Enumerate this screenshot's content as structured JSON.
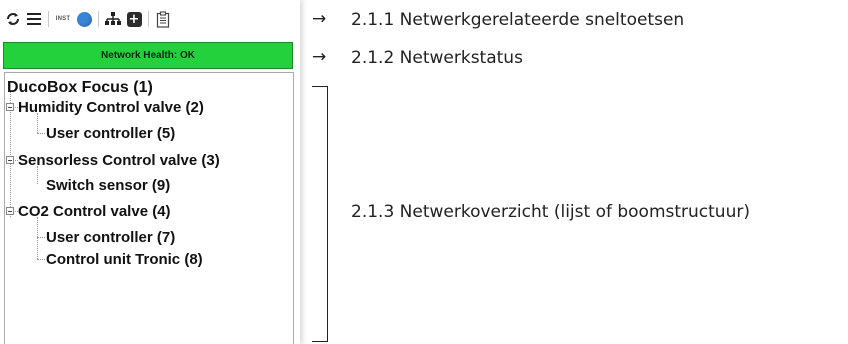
{
  "toolbar": {
    "refresh_icon": "refresh-icon",
    "menu_icon": "hamburger-icon",
    "inst_label": "INST",
    "status_icon": "blue-dot-icon",
    "network_icon": "network-icon",
    "add_icon": "plus-icon",
    "clipboard_icon": "clipboard-icon"
  },
  "health": {
    "text": "Network Health: OK",
    "color": "#22d13b"
  },
  "tree": {
    "root": "DucoBox Focus (1)",
    "n1": "Humidity Control valve (2)",
    "n1c1": "User controller (5)",
    "n2": "Sensorless Control valve (3)",
    "n2c1": "Switch sensor (9)",
    "n3": "CO2 Control valve (4)",
    "n3c1": "User controller (7)",
    "n3c2": "Control unit Tronic (8)"
  },
  "annotations": {
    "a1": "2.1.1 Netwerkgerelateerde sneltoetsen",
    "a2": "2.1.2 Netwerkstatus",
    "a3": "2.1.3 Netwerkoverzicht (lijst of boomstructuur)",
    "arrow": "→"
  }
}
